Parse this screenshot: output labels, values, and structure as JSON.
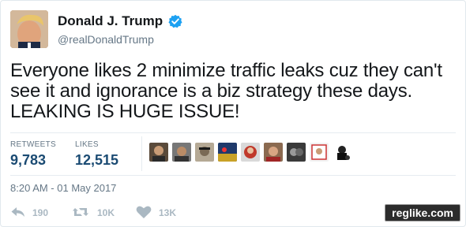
{
  "tweet": {
    "display_name": "Donald J. Trump",
    "handle": "@realDonaldTrump",
    "text": "Everyone likes 2 minimize traffic leaks cuz they can't see it and ignorance is a biz strategy these days. LEAKING IS HUGE ISSUE!",
    "timestamp": "8:20 AM - 01 May 2017"
  },
  "stats": {
    "retweets_label": "RETWEETS",
    "retweets_value": "9,783",
    "likes_label": "LIKES",
    "likes_value": "12,515"
  },
  "actions": {
    "reply_count": "190",
    "retweet_count": "10K",
    "like_count": "13K"
  },
  "watermark": "reglike.com",
  "colors": {
    "verified_badge": "#1da1f2",
    "stat_value": "#1b4b73",
    "secondary_text": "#657786",
    "action_icon": "#aab8c2"
  },
  "icons": {
    "verified": "verified-badge-icon",
    "reply": "reply-icon",
    "retweet": "retweet-icon",
    "like": "heart-icon"
  }
}
